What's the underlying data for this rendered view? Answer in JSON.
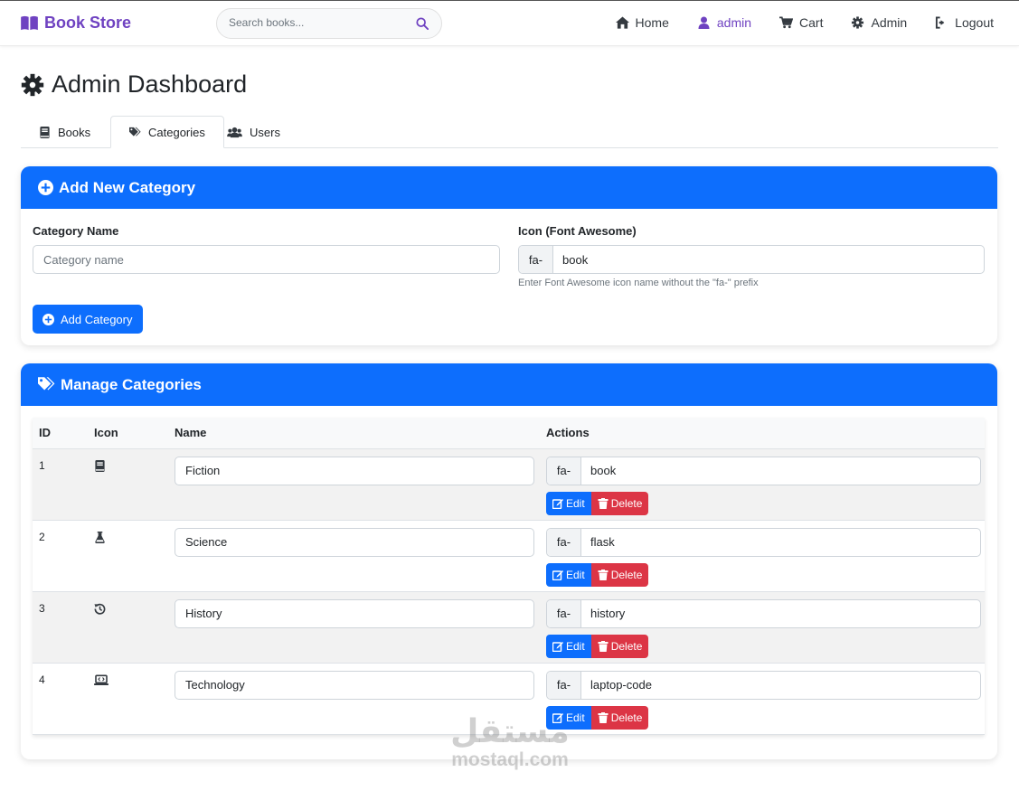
{
  "navbar": {
    "brand": "Book Store",
    "search_placeholder": "Search books...",
    "links": [
      {
        "label": "Home",
        "icon": "home-icon"
      },
      {
        "label": "admin",
        "icon": "user-icon"
      },
      {
        "label": "Cart",
        "icon": "cart-icon"
      },
      {
        "label": "Admin",
        "icon": "gear-icon"
      },
      {
        "label": "Logout",
        "icon": "logout-icon"
      }
    ]
  },
  "page": {
    "title": "Admin Dashboard",
    "tabs": [
      {
        "label": "Books",
        "icon": "book-icon",
        "active": false
      },
      {
        "label": "Categories",
        "icon": "tags-icon",
        "active": true
      },
      {
        "label": "Users",
        "icon": "users-icon",
        "active": false
      }
    ]
  },
  "add_category": {
    "header": "Add New Category",
    "name_label": "Category Name",
    "name_placeholder": "Category name",
    "icon_label": "Icon (Font Awesome)",
    "icon_prefix": "fa-",
    "icon_value": "book",
    "icon_help": "Enter Font Awesome icon name without the \"fa-\" prefix",
    "submit_label": "Add Category"
  },
  "manage": {
    "header": "Manage Categories",
    "columns": [
      "ID",
      "Icon",
      "Name",
      "Actions"
    ],
    "prefix": "fa-",
    "edit_label": "Edit",
    "delete_label": "Delete",
    "rows": [
      {
        "id": "1",
        "icon": "book-icon",
        "name": "Fiction",
        "icon_name": "book"
      },
      {
        "id": "2",
        "icon": "flask-icon",
        "name": "Science",
        "icon_name": "flask"
      },
      {
        "id": "3",
        "icon": "history-icon",
        "name": "History",
        "icon_name": "history"
      },
      {
        "id": "4",
        "icon": "laptop-code-icon",
        "name": "Technology",
        "icon_name": "laptop-code"
      }
    ]
  },
  "watermark": {
    "arabic": "مستقل",
    "latin": "mostaql.com"
  },
  "colors": {
    "brand": "#6f42c1",
    "primary": "#0d6efd",
    "danger": "#dc3545"
  }
}
